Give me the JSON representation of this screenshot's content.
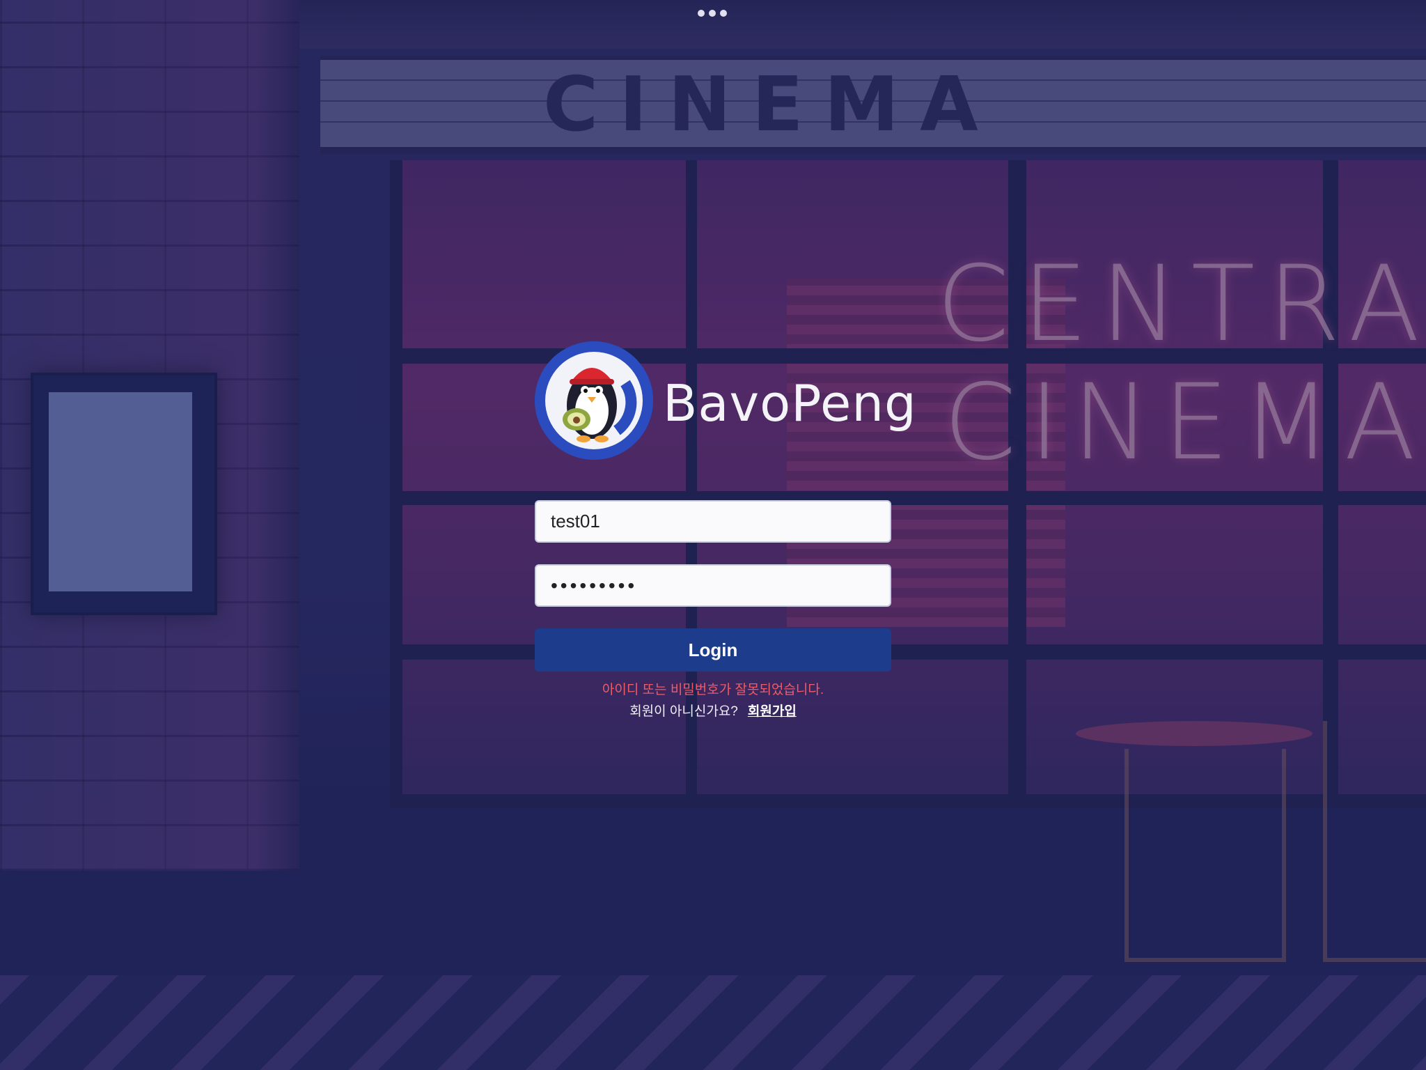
{
  "top_indicator": {
    "icon": "more-dots-icon"
  },
  "brand": {
    "name": "BavoPeng",
    "logo_icon": "penguin-avocado-logo-icon",
    "logo_color": "#2a4cbf"
  },
  "form": {
    "username_value": "test01",
    "password_value": "•••••••••",
    "login_label": "Login",
    "login_color": "#1e3c8c"
  },
  "messages": {
    "error": "아이디 또는 비밀번호가 잘못되었습니다.",
    "error_color": "#ef5b67",
    "signup_prompt": "회원이 아니신가요?",
    "signup_link": "회원가입"
  },
  "background": {
    "marquee_text": "CINEMA",
    "neon_line1": "CENTRAL",
    "neon_line2": "CINEMA"
  }
}
